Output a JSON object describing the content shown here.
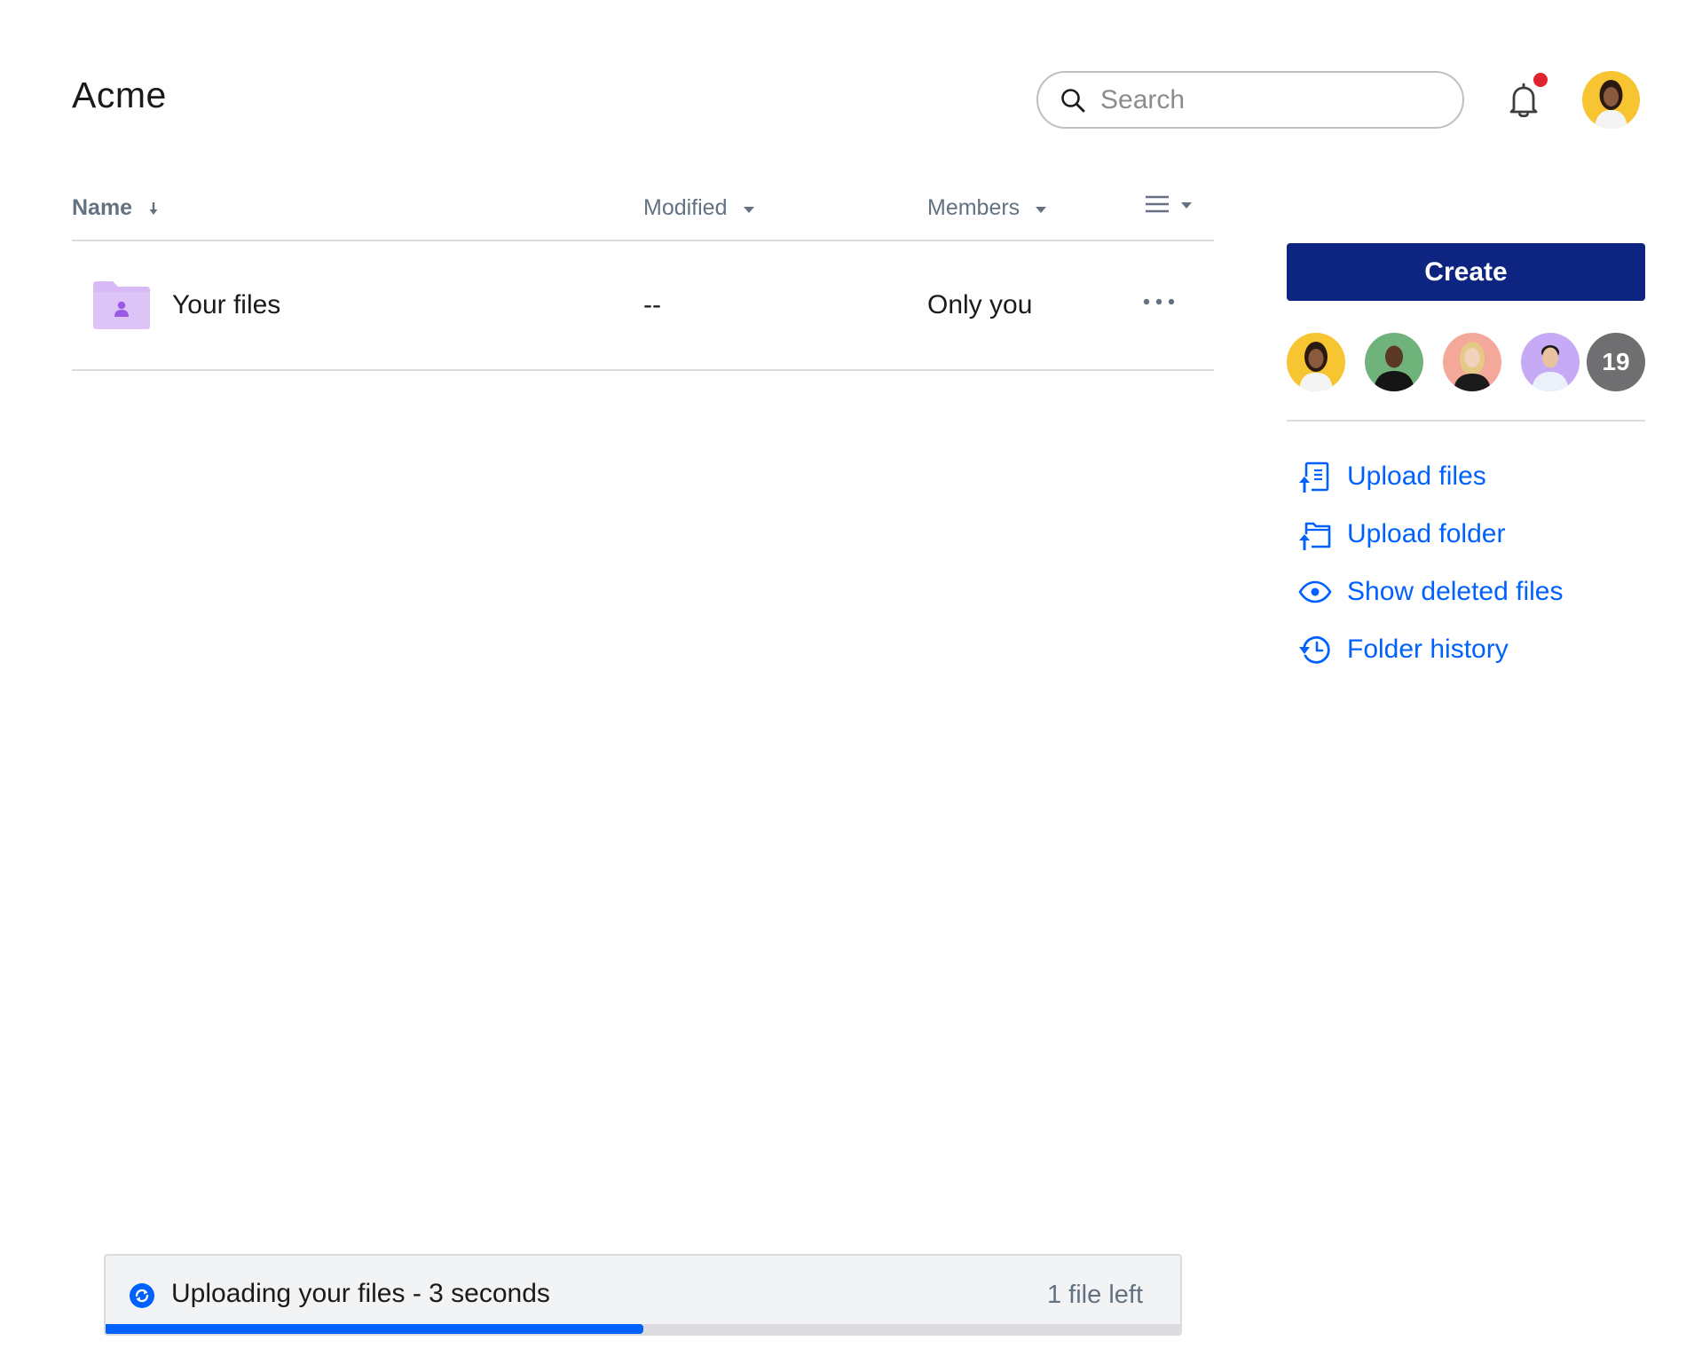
{
  "header": {
    "brand": "Acme",
    "search_placeholder": "Search",
    "has_notification": true
  },
  "table": {
    "columns": {
      "name": "Name",
      "modified": "Modified",
      "members": "Members"
    },
    "rows": [
      {
        "name": "Your files",
        "modified": "--",
        "members": "Only you"
      }
    ]
  },
  "sidebar": {
    "create_label": "Create",
    "member_count": "19",
    "actions": [
      {
        "label": "Upload files",
        "icon": "upload-files-icon"
      },
      {
        "label": "Upload folder",
        "icon": "upload-folder-icon"
      },
      {
        "label": "Show deleted files",
        "icon": "eye-icon"
      },
      {
        "label": "Folder history",
        "icon": "history-icon"
      }
    ]
  },
  "upload": {
    "status": "Uploading your files - 3 seconds",
    "remaining": "1 file left",
    "progress_fraction": 0.5
  },
  "colors": {
    "accent": "#0061fe",
    "create_button": "#0d2481",
    "notification": "#e0242d",
    "folder": "#d7b9f5"
  }
}
